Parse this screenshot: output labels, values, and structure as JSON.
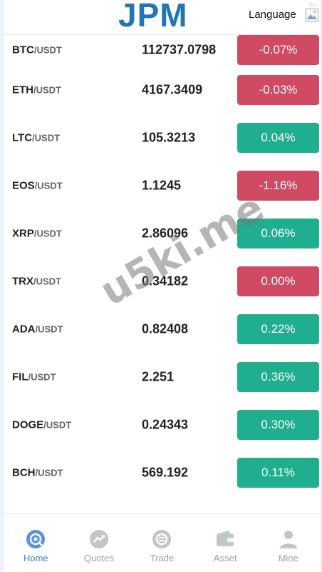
{
  "header": {
    "logo": "JPM",
    "language_label": "Language",
    "language_icon": "flag-image-icon"
  },
  "colors": {
    "brand": "#1f78b5",
    "down": "#cf4a62",
    "up": "#1fae8e",
    "active_tab": "#3c7fd8",
    "inactive_tab": "#9aa0a8"
  },
  "markets": [
    {
      "base": "BTC",
      "quote": "/USDT",
      "price": "112737.0798",
      "change": "-0.07%",
      "direction": "down"
    },
    {
      "base": "ETH",
      "quote": "/USDT",
      "price": "4167.3409",
      "change": "-0.03%",
      "direction": "down"
    },
    {
      "base": "LTC",
      "quote": "/USDT",
      "price": "105.3213",
      "change": "0.04%",
      "direction": "up"
    },
    {
      "base": "EOS",
      "quote": "/USDT",
      "price": "1.1245",
      "change": "-1.16%",
      "direction": "down"
    },
    {
      "base": "XRP",
      "quote": "/USDT",
      "price": "2.86096",
      "change": "0.06%",
      "direction": "up"
    },
    {
      "base": "TRX",
      "quote": "/USDT",
      "price": "0.34182",
      "change": "0.00%",
      "direction": "down"
    },
    {
      "base": "ADA",
      "quote": "/USDT",
      "price": "0.82408",
      "change": "0.22%",
      "direction": "up"
    },
    {
      "base": "FIL",
      "quote": "/USDT",
      "price": "2.251",
      "change": "0.36%",
      "direction": "up"
    },
    {
      "base": "DOGE",
      "quote": "/USDT",
      "price": "0.24343",
      "change": "0.30%",
      "direction": "up"
    },
    {
      "base": "BCH",
      "quote": "/USDT",
      "price": "569.192",
      "change": "0.11%",
      "direction": "up"
    }
  ],
  "watermark": "u5ki.me",
  "tabs": [
    {
      "label": "Home",
      "icon": "home-icon",
      "active": true
    },
    {
      "label": "Quotes",
      "icon": "quotes-icon",
      "active": false
    },
    {
      "label": "Trade",
      "icon": "trade-icon",
      "active": false
    },
    {
      "label": "Asset",
      "icon": "wallet-icon",
      "active": false
    },
    {
      "label": "Mine",
      "icon": "user-icon",
      "active": false
    }
  ]
}
